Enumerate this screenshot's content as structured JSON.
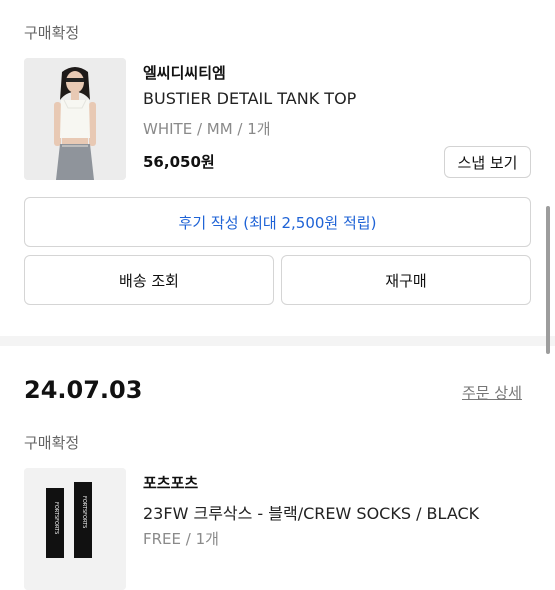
{
  "order1": {
    "status": "구매확정",
    "brand": "엘씨디씨티엠",
    "product_name": "BUSTIER DETAIL TANK TOP",
    "option": "WHITE / MM / 1개",
    "price": "56,050원",
    "snap_button": "스냅 보기",
    "review_button": "후기 작성 (최대 2,500원 적립)",
    "shipping_button": "배송 조회",
    "rebuy_button": "재구매"
  },
  "order2": {
    "date": "24.07.03",
    "detail_link": "주문 상세",
    "status": "구매확정",
    "brand": "포츠포츠",
    "product_name": "23FW 크루삭스 - 블랙/CREW SOCKS / BLACK",
    "option": "FREE / 1개",
    "sock_text": "FORTSFORTS"
  },
  "colors": {
    "accent": "#1f63d6",
    "muted": "#8a8a8a",
    "border": "#d5d5d5"
  }
}
